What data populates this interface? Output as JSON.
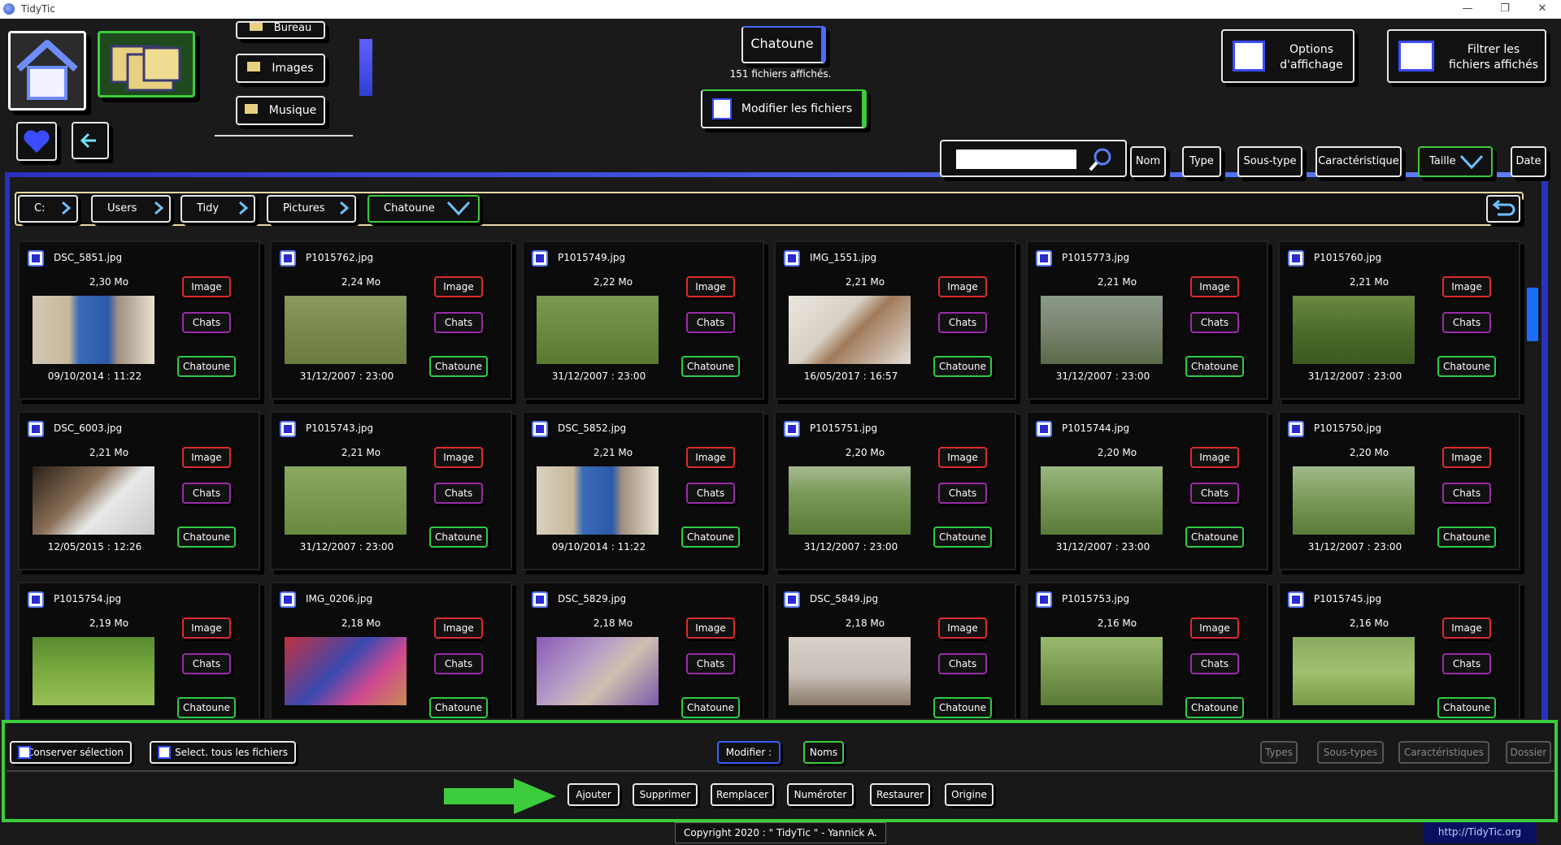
{
  "window": {
    "title": "TidyTic"
  },
  "shortcuts": [
    "Bureau",
    "Images",
    "Musique"
  ],
  "folder": {
    "name": "Chatoune",
    "count_text": "151 fichiers affichés."
  },
  "header": {
    "modify_button": "Modifier les fichiers",
    "options_button": "Options d'affichage",
    "filter_button": "Filtrer les fichiers affichés"
  },
  "search": {
    "value": ""
  },
  "sort_buttons": [
    "Nom",
    "Type",
    "Sous-type",
    "Caractéristique",
    "Taille",
    "Date"
  ],
  "breadcrumb": [
    "C:",
    "Users",
    "Tidy",
    "Pictures",
    "Chatoune"
  ],
  "tags": {
    "type": "Image",
    "subtype": "Chats",
    "feature": "Chatoune"
  },
  "files": [
    {
      "name": "DSC_5851.jpg",
      "size": "2,30 Mo",
      "date": "09/10/2014 : 11:22"
    },
    {
      "name": "P1015762.jpg",
      "size": "2,24 Mo",
      "date": "31/12/2007 : 23:00"
    },
    {
      "name": "P1015749.jpg",
      "size": "2,22 Mo",
      "date": "31/12/2007 : 23:00"
    },
    {
      "name": "IMG_1551.jpg",
      "size": "2,21 Mo",
      "date": "16/05/2017 : 16:57"
    },
    {
      "name": "P1015773.jpg",
      "size": "2,21 Mo",
      "date": "31/12/2007 : 23:00"
    },
    {
      "name": "P1015760.jpg",
      "size": "2,21 Mo",
      "date": "31/12/2007 : 23:00"
    },
    {
      "name": "DSC_6003.jpg",
      "size": "2,21 Mo",
      "date": "12/05/2015 : 12:26"
    },
    {
      "name": "P1015743.jpg",
      "size": "2,21 Mo",
      "date": "31/12/2007 : 23:00"
    },
    {
      "name": "DSC_5852.jpg",
      "size": "2,21 Mo",
      "date": "09/10/2014 : 11:22"
    },
    {
      "name": "P1015751.jpg",
      "size": "2,20 Mo",
      "date": "31/12/2007 : 23:00"
    },
    {
      "name": "P1015744.jpg",
      "size": "2,20 Mo",
      "date": "31/12/2007 : 23:00"
    },
    {
      "name": "P1015750.jpg",
      "size": "2,20 Mo",
      "date": "31/12/2007 : 23:00"
    },
    {
      "name": "P1015754.jpg",
      "size": "2,19 Mo",
      "date": ""
    },
    {
      "name": "IMG_0206.jpg",
      "size": "2,18 Mo",
      "date": ""
    },
    {
      "name": "DSC_5829.jpg",
      "size": "2,18 Mo",
      "date": ""
    },
    {
      "name": "DSC_5849.jpg",
      "size": "2,18 Mo",
      "date": ""
    },
    {
      "name": "P1015753.jpg",
      "size": "2,16 Mo",
      "date": ""
    },
    {
      "name": "P1015745.jpg",
      "size": "2,16 Mo",
      "date": ""
    }
  ],
  "bottom": {
    "keep_selection": "Conserver sélection",
    "select_all": "Select. tous les fichiers",
    "modify_label": "Modifier :",
    "names": "Noms",
    "types": "Types",
    "subtypes": "Sous-types",
    "features": "Caractéristiques",
    "folder": "Dossier",
    "actions": [
      "Ajouter",
      "Supprimer",
      "Remplacer",
      "Numéroter",
      "Restaurer",
      "Origine"
    ]
  },
  "footer": {
    "copyright": "Copyright 2020 : \" TidyTic \" - Yannick A.",
    "link": "http://TidyTic.org"
  },
  "colors": {
    "accent_blue": "#3a5cff",
    "accent_green": "#2ccc44",
    "accent_red": "#e02a2a",
    "accent_purple": "#9a2ca8"
  }
}
